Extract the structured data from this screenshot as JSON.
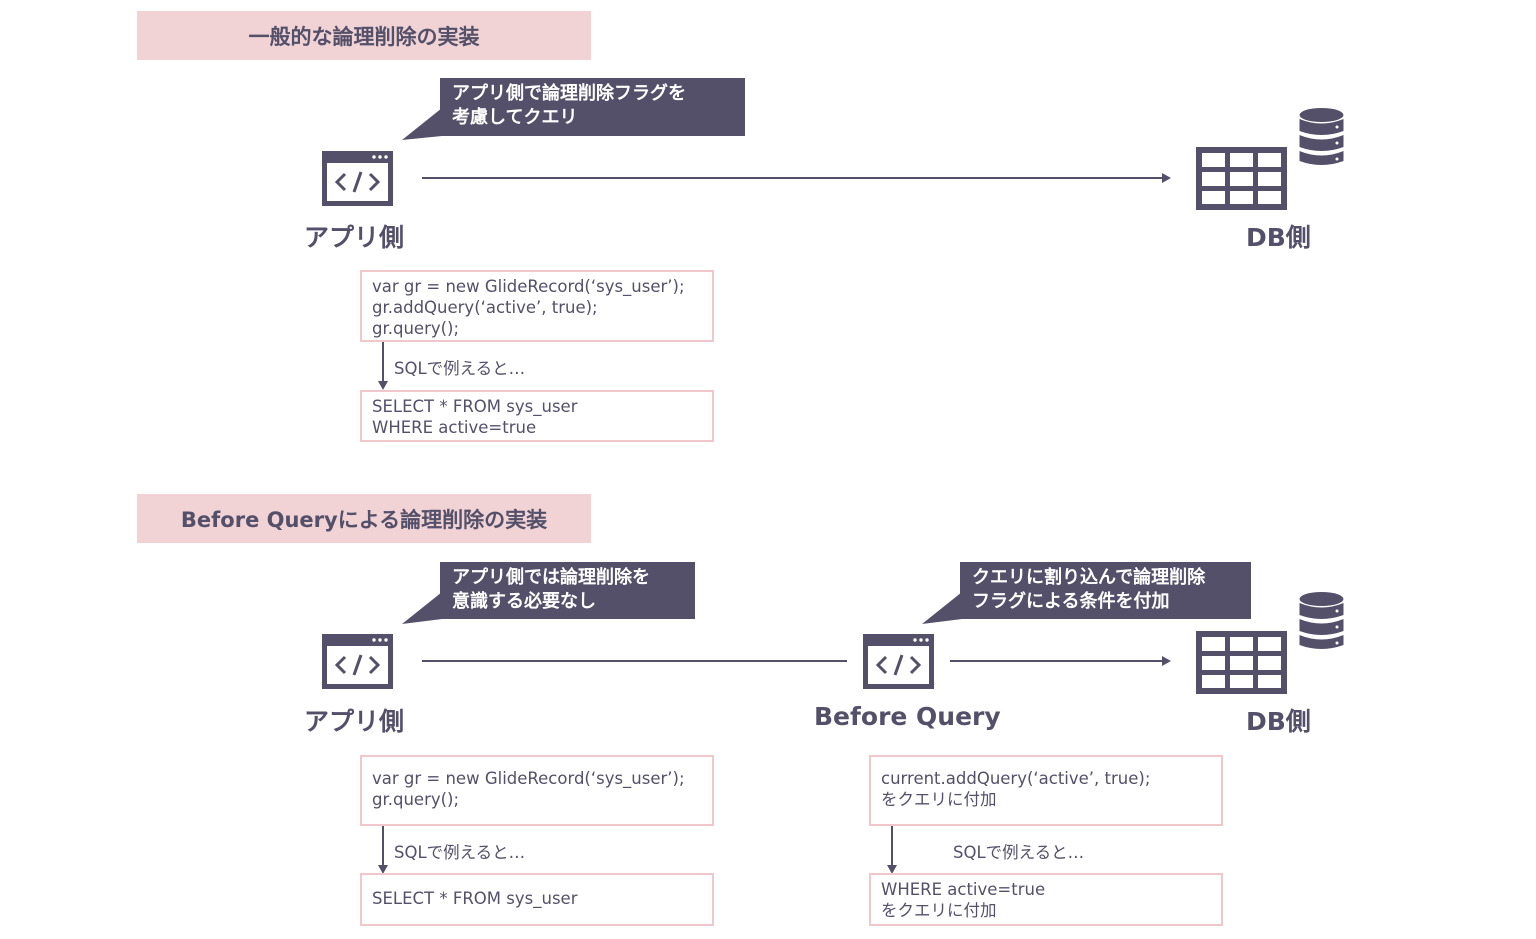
{
  "section1": {
    "title": "一般的な論理削除の実装",
    "bubble": "アプリ側で論理削除フラグを\n考慮してクエリ",
    "app_label": "アプリ側",
    "db_label": "DB側",
    "app_code": "var gr = new GlideRecord(‘sys_user’);\ngr.addQuery(‘active’, true);\ngr.query();",
    "sql_note": "SQLで例えると…",
    "sql_code": "SELECT * FROM sys_user\nWHERE active=true"
  },
  "section2": {
    "title": "Before Queryによる論理削除の実装",
    "bubble_app": "アプリ側では論理削除を\n意識する必要なし",
    "bubble_bq": "クエリに割り込んで論理削除\nフラグによる条件を付加",
    "app_label": "アプリ側",
    "bq_label": "Before Query",
    "db_label": "DB側",
    "app_code": "var gr = new GlideRecord(‘sys_user’);\ngr.query();",
    "app_sql_note": "SQLで例えると…",
    "app_sql_code": "SELECT * FROM sys_user",
    "bq_code": "current.addQuery(‘active’, true);\nをクエリに付加",
    "bq_sql_note": "SQLで例えると…",
    "bq_sql_code": "WHERE active=true\nをクエリに付加"
  },
  "icons": {
    "app": "code-window-icon",
    "table": "table-grid-icon",
    "database": "database-icon"
  },
  "colors": {
    "primary": "#54506a",
    "band": "#f2d3d5",
    "box_border": "#f0c8cb"
  }
}
